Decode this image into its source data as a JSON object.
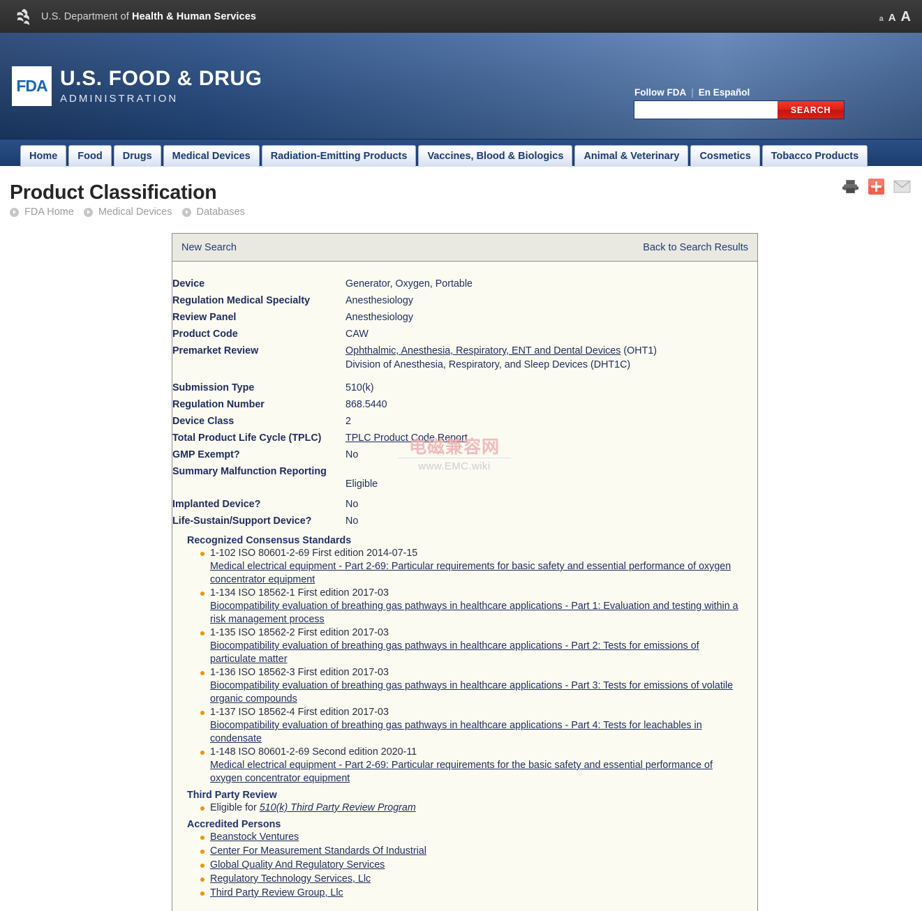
{
  "hhs": {
    "agency_text_plain": "U.S. Department of ",
    "agency_text_bold": "Health & Human Services",
    "font_small": "a",
    "font_medium": "A",
    "font_large": "A"
  },
  "banner": {
    "logo_mark": "FDA",
    "title": "U.S. FOOD & DRUG",
    "subtitle": "ADMINISTRATION",
    "follow_fda": "Follow FDA",
    "separator": "|",
    "en_espanol": "En Español",
    "search_value": "",
    "search_placeholder": "",
    "search_button": "SEARCH"
  },
  "nav": {
    "tabs": [
      {
        "label": "Home"
      },
      {
        "label": "Food"
      },
      {
        "label": "Drugs"
      },
      {
        "label": "Medical Devices"
      },
      {
        "label": "Radiation-Emitting Products"
      },
      {
        "label": "Vaccines, Blood & Biologics"
      },
      {
        "label": "Animal & Veterinary"
      },
      {
        "label": "Cosmetics"
      },
      {
        "label": "Tobacco Products"
      }
    ]
  },
  "header": {
    "page_title": "Product Classification",
    "breadcrumb": [
      {
        "label": "FDA Home"
      },
      {
        "label": "Medical Devices"
      },
      {
        "label": "Databases"
      }
    ],
    "tools": [
      {
        "name": "print-icon"
      },
      {
        "name": "share-icon"
      },
      {
        "name": "email-icon"
      }
    ]
  },
  "panel": {
    "new_search": "New Search",
    "back_to_results": "Back to Search Results",
    "fields": [
      {
        "label": "Device",
        "value": "Generator, Oxygen, Portable"
      },
      {
        "label": "Regulation Medical Specialty",
        "value": "Anesthesiology"
      },
      {
        "label": "Review Panel",
        "value": "Anesthesiology"
      },
      {
        "label": "Product Code",
        "value": "CAW"
      },
      {
        "label": "Premarket Review",
        "link": "Ophthalmic, Anesthesia, Respiratory, ENT and Dental Devices",
        "value_suffix": " (OHT1)",
        "value_line2": "Division of Anesthesia, Respiratory, and Sleep Devices (DHT1C)"
      },
      {
        "label": "Submission Type",
        "value": "510(k)"
      },
      {
        "label": "Regulation Number",
        "value": "868.5440"
      },
      {
        "label": "Device Class",
        "value": "2"
      },
      {
        "label": "Total Product Life Cycle (TPLC)",
        "link": "TPLC Product Code Report"
      },
      {
        "label": "GMP Exempt?",
        "value": "No"
      },
      {
        "label": "Summary Malfunction Reporting",
        "value": "Eligible"
      },
      {
        "label": "Implanted Device?",
        "value": "No"
      },
      {
        "label": "Life-Sustain/Support Device?",
        "value": "No"
      }
    ],
    "consensus_standards": {
      "heading": "Recognized Consensus Standards",
      "items": [
        {
          "ref": "1-102 ISO 80601-2-69 First edition 2014-07-15",
          "title": "Medical electrical equipment - Part 2-69: Particular requirements for basic safety and essential performance of oxygen concentrator equipment"
        },
        {
          "ref": "1-134 ISO 18562-1 First edition 2017-03",
          "title": "Biocompatibility evaluation of breathing gas pathways in healthcare applications - Part 1: Evaluation and testing within a risk management process"
        },
        {
          "ref": "1-135 ISO 18562-2 First edition 2017-03",
          "title": "Biocompatibility evaluation of breathing gas pathways in healthcare applications - Part 2: Tests for emissions of particulate matter"
        },
        {
          "ref": "1-136 ISO 18562-3 First edition 2017-03",
          "title": "Biocompatibility evaluation of breathing gas pathways in healthcare applications - Part 3: Tests for emissions of volatile organic compounds"
        },
        {
          "ref": "1-137 ISO 18562-4 First edition 2017-03",
          "title": "Biocompatibility evaluation of breathing gas pathways in healthcare applications - Part 4: Tests for leachables in condensate"
        },
        {
          "ref": "1-148 ISO 80601-2-69 Second edition 2020-11",
          "title": "Medical electrical equipment - Part 2-69: Particular requirements for the basic safety and essential performance of oxygen concentrator equipment"
        }
      ]
    },
    "third_party_review": {
      "heading": "Third Party Review",
      "prefix": "Eligible for ",
      "link": "510(k) Third Party Review Program"
    },
    "accredited_persons": {
      "heading": "Accredited Persons",
      "items": [
        {
          "label": "Beanstock Ventures"
        },
        {
          "label": "Center For Measurement Standards Of Industrial"
        },
        {
          "label": "Global Quality And Regulatory Services"
        },
        {
          "label": "Regulatory Technology Services, Llc"
        },
        {
          "label": "Third Party Review Group, Llc"
        }
      ]
    }
  },
  "watermark": {
    "chinese": "电磁兼容网",
    "url": "www.EMC.wiki"
  },
  "colors": {
    "hhs_bar": "#343434",
    "fda_blue": "#234a82",
    "nav_blue": "#1d3c6c",
    "search_red": "#d8201a",
    "link_navy": "#1f2c5c",
    "bullet_orange": "#e8930c",
    "panel_bg": "#fbfbf2",
    "panel_head_bg": "#e9e9e1"
  }
}
